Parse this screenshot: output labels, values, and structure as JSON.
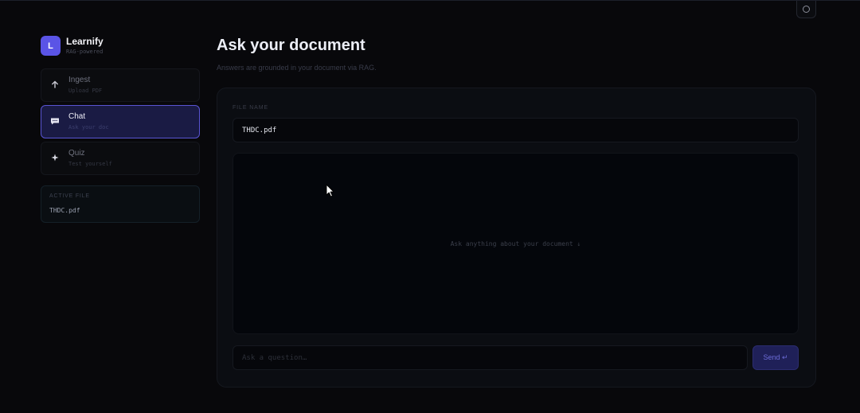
{
  "app": {
    "logo_letter": "L",
    "name": "Learnify",
    "tagline": "RAG-powered",
    "theme_toggle_icon": "circle-icon"
  },
  "sidebar": {
    "items": [
      {
        "label": "Ingest",
        "sub": "Upload PDF",
        "icon": "arrow-up-icon",
        "active": false
      },
      {
        "label": "Chat",
        "sub": "Ask your doc",
        "icon": "chat-bubble-icon",
        "active": true
      },
      {
        "label": "Quiz",
        "sub": "Test yourself",
        "icon": "sparkle-icon",
        "active": false
      }
    ],
    "active_file": {
      "label": "ACTIVE FILE",
      "value": "THDC.pdf"
    }
  },
  "main": {
    "title": "Ask your document",
    "subtitle": "Answers are grounded in your document via RAG.",
    "file_name_label": "FILE NAME",
    "file_name_value": "THDC.pdf",
    "chat_empty_text": "Ask anything about your document ↓",
    "question_placeholder": "Ask a question…",
    "question_value": "",
    "send_label": "Send ↵"
  },
  "colors": {
    "accent": "#5a54e6",
    "background": "#08080b",
    "card": "#0b0d12",
    "active_nav_bg": "#1a1b44"
  }
}
